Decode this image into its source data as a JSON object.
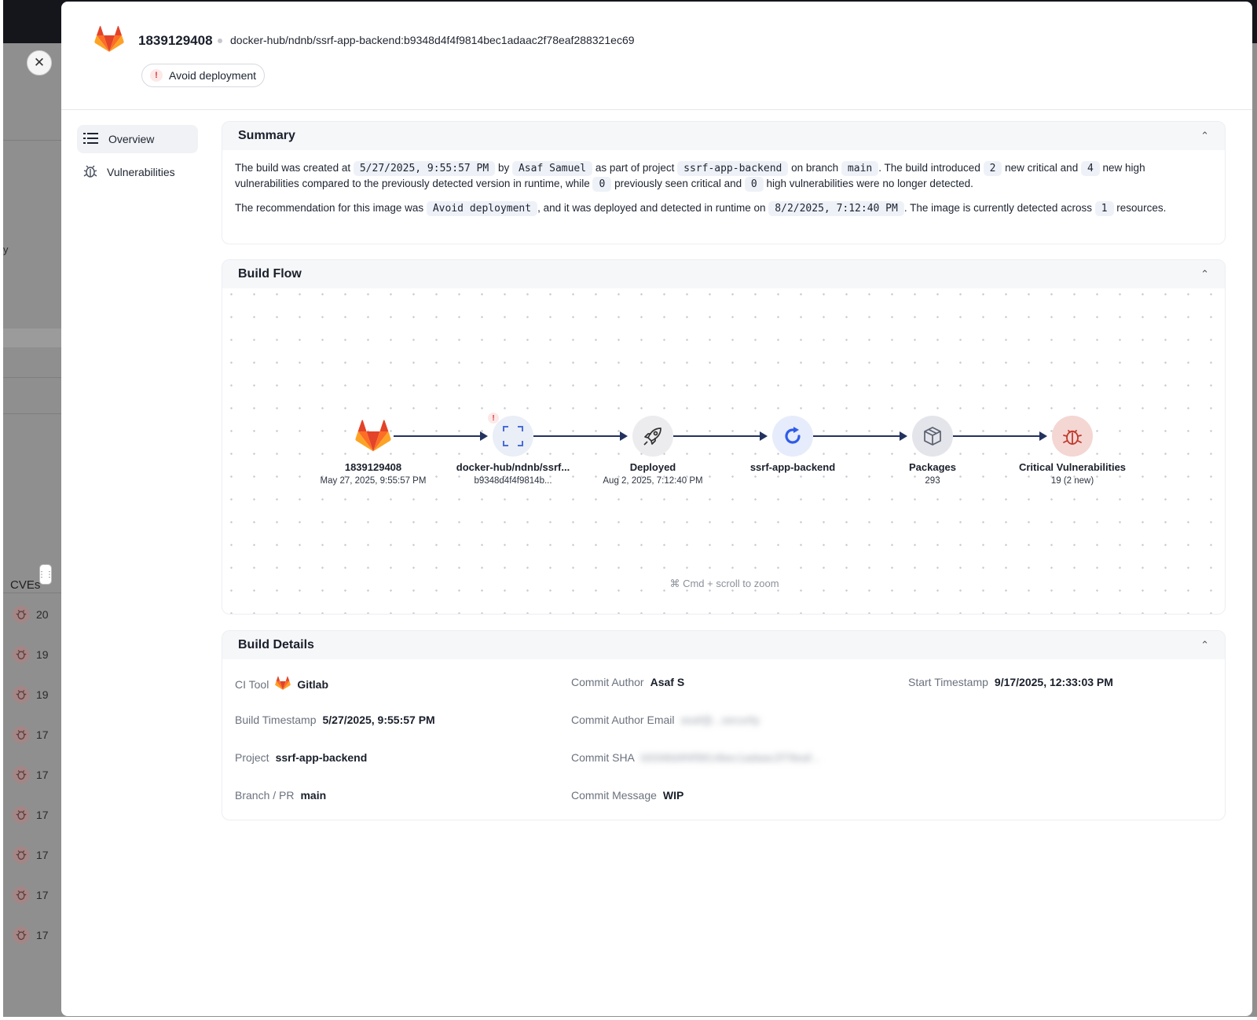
{
  "backdrop": {
    "close_label": "✕",
    "stray_text": "y",
    "cves_label": "CVEs",
    "rows": [
      "20",
      "19",
      "19",
      "17",
      "17",
      "17",
      "17",
      "17",
      "17"
    ]
  },
  "header": {
    "build_id": "1839129408",
    "image_ref": "docker-hub/ndnb/ssrf-app-backend:b9348d4f4f9814bec1adaac2f78eaf288321ec69",
    "recommendation_badge": "Avoid deployment",
    "badge_mark": "!"
  },
  "nav": {
    "items": [
      {
        "label": "Overview",
        "icon": "list-icon"
      },
      {
        "label": "Vulnerabilities",
        "icon": "bug-icon"
      }
    ]
  },
  "summary": {
    "title": "Summary",
    "p1": {
      "t1": "The build was created at ",
      "created": "5/27/2025, 9:55:57 PM",
      "t2": " by ",
      "author": "Asaf Samuel",
      "t3": " as part of project ",
      "project": "ssrf-app-backend",
      "t4": " on branch ",
      "branch": "main",
      "t5": ". The build introduced ",
      "new_critical": "2",
      "t6": " new critical and ",
      "new_high": "4",
      "t7": " new high vulnerabilities compared to the previously detected version in runtime, while ",
      "old_critical": "0",
      "t8": " previously seen critical and ",
      "old_high": "0",
      "t9": " high vulnerabilities were no longer detected."
    },
    "p2": {
      "t1": "The recommendation for this image was ",
      "recommendation": "Avoid deployment",
      "t2": ", and it was deployed and detected in runtime on ",
      "deployed": "8/2/2025, 7:12:40 PM",
      "t3": ". The image is currently detected across ",
      "resources": "1",
      "t4": " resources."
    }
  },
  "build_flow": {
    "title": "Build Flow",
    "nodes": [
      {
        "label": "1839129408",
        "sub": "May 27, 2025, 9:55:57 PM",
        "icon": "gitlab-icon"
      },
      {
        "label": "docker-hub/ndnb/ssrf...",
        "sub": "b9348d4f4f9814b...",
        "icon": "scan-icon",
        "alert": "!"
      },
      {
        "label": "Deployed",
        "sub": "Aug 2, 2025, 7:12:40 PM",
        "icon": "rocket-icon"
      },
      {
        "label": "ssrf-app-backend",
        "sub": "",
        "icon": "refresh-icon"
      },
      {
        "label": "Packages",
        "sub": "293",
        "icon": "package-icon"
      },
      {
        "label": "Critical Vulnerabilities",
        "sub": "19 (2 new)",
        "icon": "bug-icon"
      }
    ],
    "zoom_hint": "⌘ Cmd + scroll to zoom"
  },
  "build_details": {
    "title": "Build Details",
    "fields": {
      "ci_tool": {
        "label": "CI Tool",
        "value": "Gitlab"
      },
      "commit_author": {
        "label": "Commit Author",
        "value": "Asaf S"
      },
      "start_timestamp": {
        "label": "Start Timestamp",
        "value": "9/17/2025, 12:33:03 PM"
      },
      "build_timestamp": {
        "label": "Build Timestamp",
        "value": "5/27/2025, 9:55:57 PM"
      },
      "commit_author_email": {
        "label": "Commit Author Email",
        "value": "asaf@...security"
      },
      "project": {
        "label": "Project",
        "value": "ssrf-app-backend"
      },
      "commit_sha": {
        "label": "Commit SHA",
        "value": "b9348d4f4f9814bec1adaac2f78eaf..."
      },
      "branch": {
        "label": "Branch / PR",
        "value": "main"
      },
      "commit_message": {
        "label": "Commit Message",
        "value": "WIP"
      }
    }
  },
  "colors": {
    "accent": "#2f5bea",
    "edge": "#23325f",
    "gitlab_orange": "#e24329",
    "critical_red": "#c0392b"
  }
}
